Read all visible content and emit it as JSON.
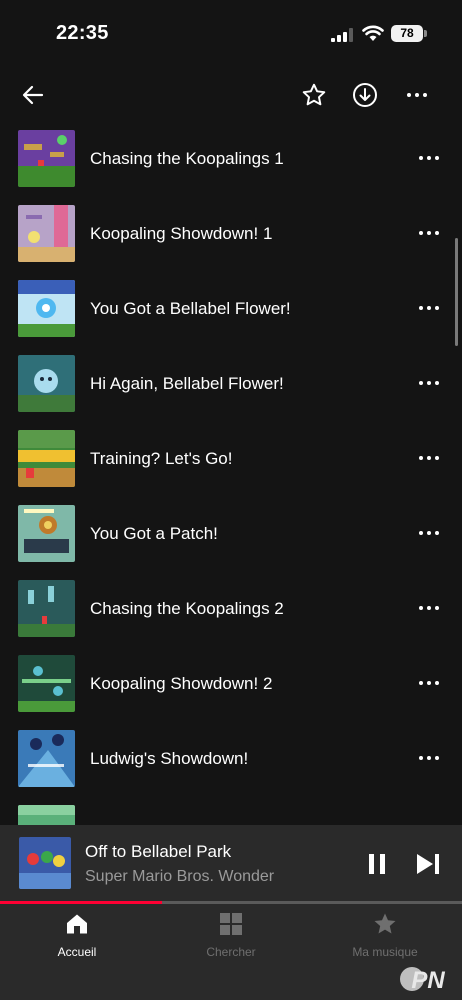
{
  "status_bar": {
    "time": "22:35",
    "battery": "78"
  },
  "top_bar": {
    "back_icon": "arrow-left-icon",
    "favorite_icon": "star-outline-icon",
    "download_icon": "download-icon",
    "more_icon": "more-horiz-icon"
  },
  "tracks": [
    {
      "title": "Chasing the Koopalings 1"
    },
    {
      "title": "Koopaling Showdown! 1"
    },
    {
      "title": "You Got a Bellabel Flower!"
    },
    {
      "title": "Hi Again, Bellabel Flower!"
    },
    {
      "title": "Training? Let's Go!"
    },
    {
      "title": "You Got a Patch!"
    },
    {
      "title": "Chasing the Koopalings 2"
    },
    {
      "title": "Koopaling Showdown! 2"
    },
    {
      "title": "Ludwig's Showdown!"
    },
    {
      "title": ""
    }
  ],
  "mini_player": {
    "title": "Off to Bellabel Park",
    "artist": "Super Mario Bros. Wonder",
    "progress_fraction": 0.35
  },
  "nav": {
    "items": [
      {
        "label": "Accueil",
        "icon": "home-icon",
        "active": true
      },
      {
        "label": "Chercher",
        "icon": "grid-icon",
        "active": false
      },
      {
        "label": "Ma musique",
        "icon": "star-icon",
        "active": false
      }
    ]
  },
  "watermark": {
    "text": "PN"
  },
  "colors": {
    "accent": "#ff0033",
    "background": "#141414",
    "surface": "#2a2a2a"
  }
}
